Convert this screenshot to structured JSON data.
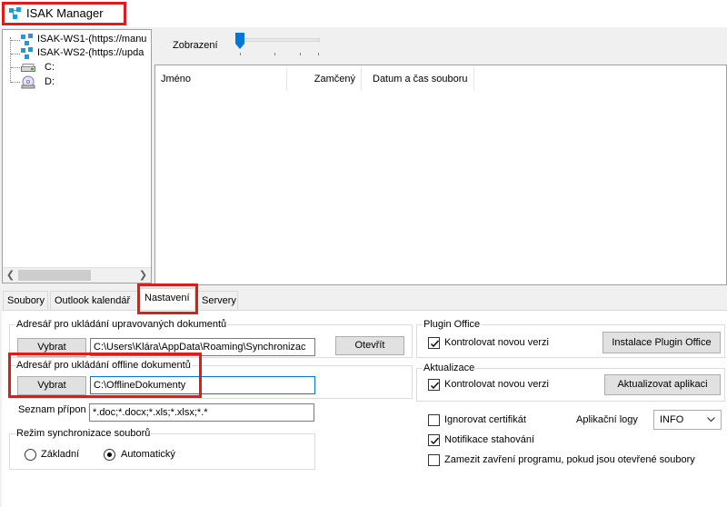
{
  "window": {
    "title": "ISAK Manager"
  },
  "tree": {
    "items": [
      {
        "label": "ISAK-WS1-(https://manu",
        "icon": "network-icon"
      },
      {
        "label": "ISAK-WS2-(https://upda",
        "icon": "network-icon"
      },
      {
        "label": "C:",
        "icon": "drive-icon"
      },
      {
        "label": "D:",
        "icon": "cd-drive-icon"
      }
    ]
  },
  "zoom": {
    "label": "Zobrazení"
  },
  "file_list": {
    "columns": [
      "Jméno",
      "Zamčený",
      "Datum a čas souboru"
    ]
  },
  "tabs": [
    {
      "label": "Soubory",
      "active": false
    },
    {
      "label": "Outlook kalendář",
      "active": false
    },
    {
      "label": "Nastavení",
      "active": true
    },
    {
      "label": "Servery",
      "active": false
    }
  ],
  "settings": {
    "edited_docs": {
      "group_title": "Adresář pro ukládání upravovaných dokumentů",
      "select_label": "Vybrat",
      "path": "C:\\Users\\Klára\\AppData\\Roaming\\Synchronizac",
      "open_label": "Otevřít"
    },
    "offline_docs": {
      "group_title": "Adresář pro ukládání offline dokumentů",
      "select_label": "Vybrat",
      "path": "C:\\OfflineDokumenty"
    },
    "extensions": {
      "label": "Seznam přípon",
      "value": "*.doc;*.docx;*.xls;*.xlsx;*.*"
    },
    "sync_mode": {
      "group_title": "Režim synchronizace souborů",
      "options": [
        {
          "label": "Základní",
          "selected": false
        },
        {
          "label": "Automatický",
          "selected": true
        }
      ]
    },
    "plugin_office": {
      "group_title": "Plugin Office",
      "check_label": "Kontrolovat novou verzi",
      "checked": true,
      "install_label": "Instalace Plugin Office"
    },
    "update": {
      "group_title": "Aktualizace",
      "check_label": "Kontrolovat novou verzi",
      "checked": true,
      "update_label": "Aktualizovat aplikaci"
    },
    "ignore_cert": {
      "label": "Ignorovat certifikát",
      "checked": false
    },
    "app_logs": {
      "label": "Aplikační logy",
      "value": "INFO"
    },
    "download_notify": {
      "label": "Notifikace stahování",
      "checked": true
    },
    "prevent_close": {
      "label": "Zamezit zavření programu, pokud jsou otevřené soubory",
      "checked": false
    }
  },
  "colors": {
    "highlight_box": "#e01b1b",
    "focus_border": "#0078d7",
    "network_icon": "#1e9bd7"
  }
}
